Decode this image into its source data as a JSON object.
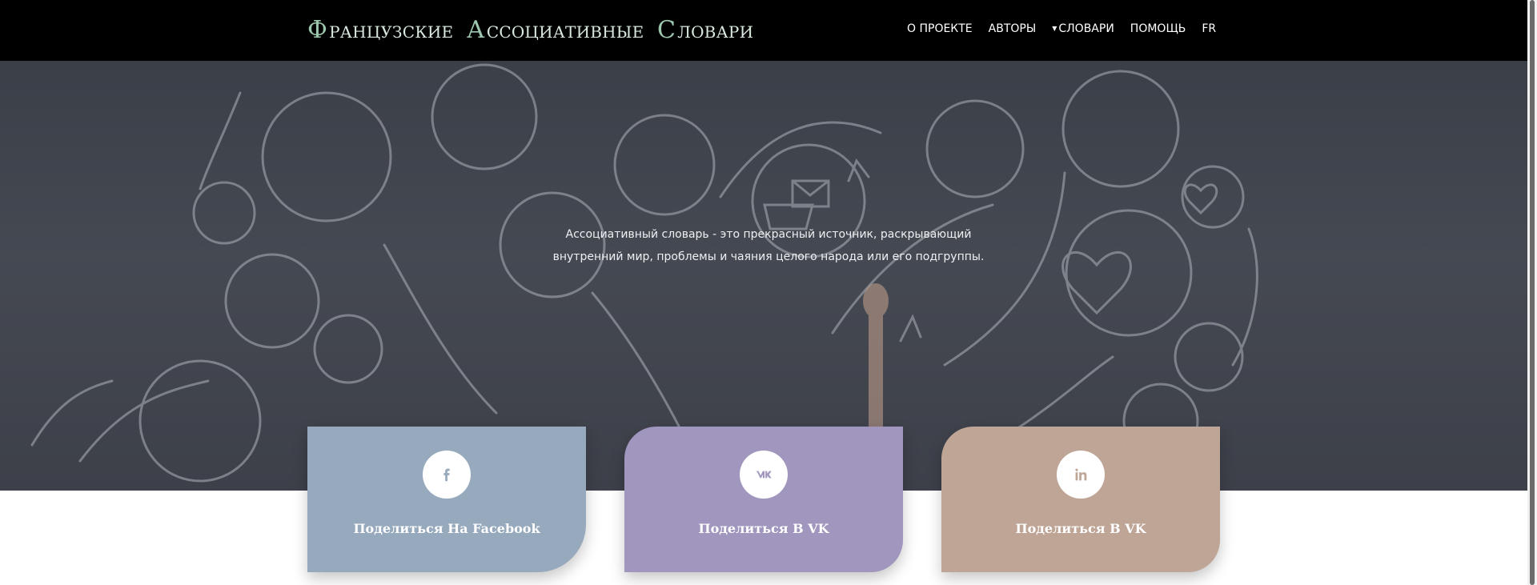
{
  "header": {
    "brand": [
      {
        "cap": "Ф",
        "rest": "РАНЦУЗСКИЕ"
      },
      {
        "cap": "А",
        "rest": "ССОЦИАТИВНЫЕ"
      },
      {
        "cap": "С",
        "rest": "ЛОВАРИ"
      }
    ],
    "nav": {
      "about": "О ПРОЕКТЕ",
      "authors": "АВТОРЫ",
      "dictionaries": "СЛОВАРИ",
      "help": "ПОМОЩЬ",
      "lang": "FR"
    }
  },
  "hero": {
    "line1": "Ассоциативный словарь - это прекрасный источник, раскрывающий",
    "line2": "внутренний мир, проблемы и чаяния целого народа или его подгруппы."
  },
  "cards": [
    {
      "label": "Поделиться На Facebook",
      "icon": "facebook-icon",
      "color": "#97a9bd"
    },
    {
      "label": "Поделиться В VK",
      "icon": "vk-icon",
      "color": "#a196bd"
    },
    {
      "label": "Поделиться В VK",
      "icon": "linkedin-icon",
      "color": "#bfa596"
    }
  ]
}
